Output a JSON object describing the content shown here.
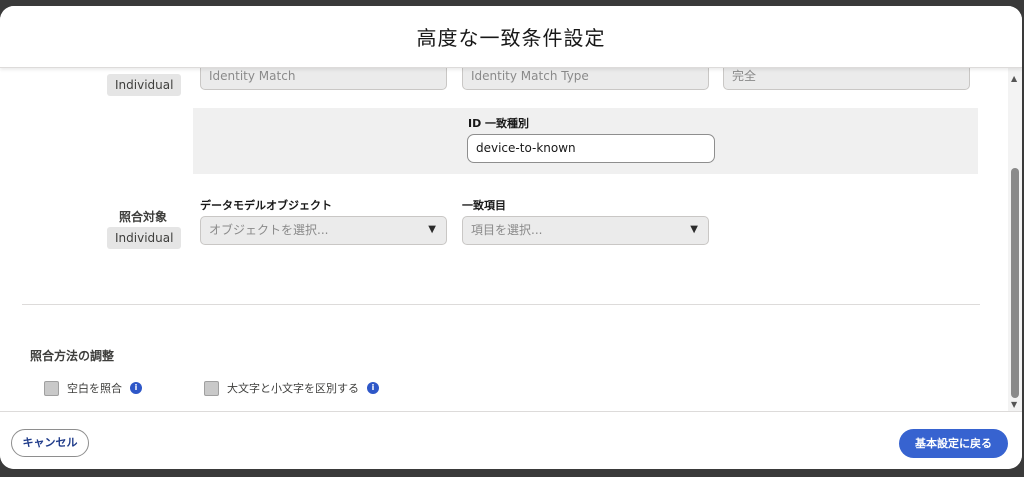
{
  "modal": {
    "title": "高度な一致条件設定"
  },
  "top_row": {
    "pill": "Individual",
    "field1_value": "Identity Match",
    "field2_value": "Identity Match Type",
    "field3_value": "完全"
  },
  "id_match": {
    "label": "ID 一致種別",
    "value": "device-to-known"
  },
  "match_target": {
    "label": "照合対象",
    "pill": "Individual",
    "dmo_label": "データモデルオブジェクト",
    "dmo_placeholder": "オブジェクトを選択...",
    "field_label": "一致項目",
    "field_placeholder": "項目を選択..."
  },
  "adjust": {
    "title": "照合方法の調整",
    "option1": "空白を照合",
    "option2": "大文字と小文字を区別する"
  },
  "footer": {
    "cancel": "キャンセル",
    "back": "基本設定に戻る"
  },
  "colors": {
    "primary": "#3763d0",
    "info": "#2e57c8"
  }
}
